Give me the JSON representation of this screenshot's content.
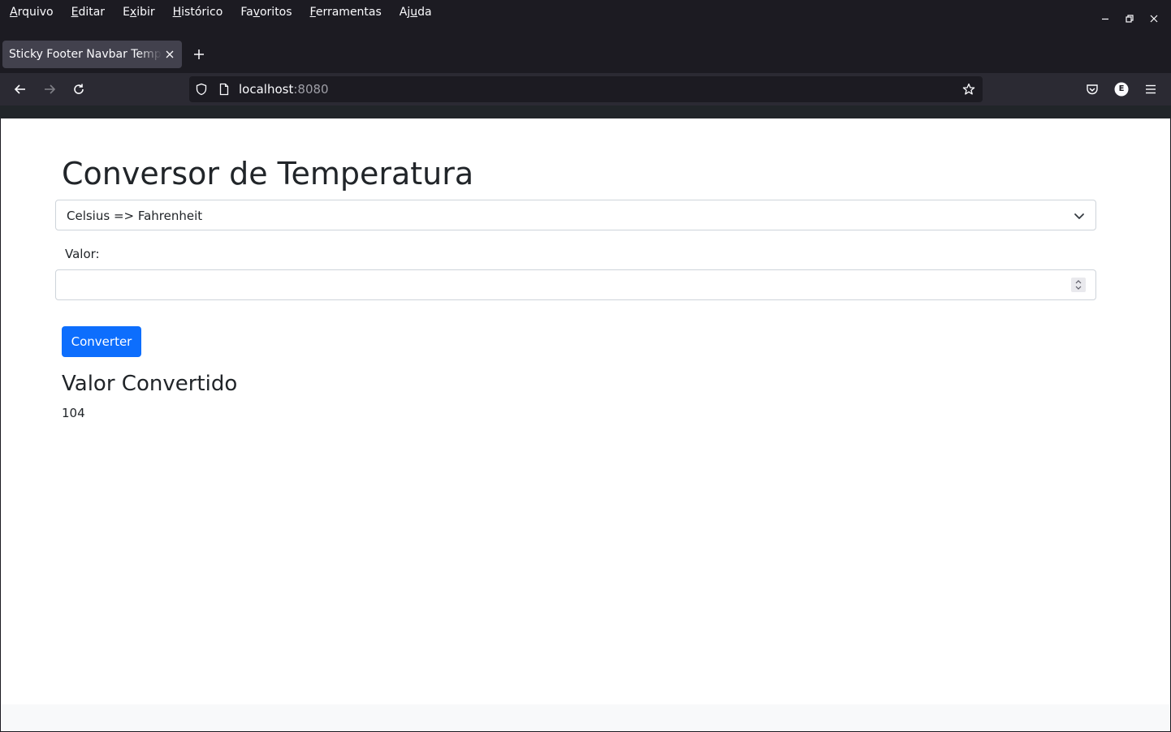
{
  "browser": {
    "menu": [
      {
        "mnemonic": "A",
        "rest": "rquivo"
      },
      {
        "mnemonic": "E",
        "rest": "ditar"
      },
      {
        "pre": "E",
        "mnemonic": "x",
        "rest": "ibir"
      },
      {
        "mnemonic": "H",
        "rest": "istórico"
      },
      {
        "pre": "Fa",
        "mnemonic": "v",
        "rest": "oritos"
      },
      {
        "mnemonic": "F",
        "rest": "erramentas"
      },
      {
        "pre": "Aj",
        "mnemonic": "u",
        "rest": "da"
      }
    ],
    "tab_title": "Sticky Footer Navbar Template · Bootstrap",
    "url_host": "localhost",
    "url_port": ":8080",
    "account_initial": "E"
  },
  "page": {
    "title": "Conversor de Temperatura",
    "conversion_select": {
      "selected": "Celsius => Fahrenheit"
    },
    "value_label": "Valor:",
    "value_input": "",
    "convert_button": "Converter",
    "result_heading": "Valor Convertido",
    "result_value": "104"
  },
  "colors": {
    "primary": "#0d6efd",
    "text": "#212529",
    "border": "#ced4da",
    "footer_bg": "#f8f9fa"
  }
}
